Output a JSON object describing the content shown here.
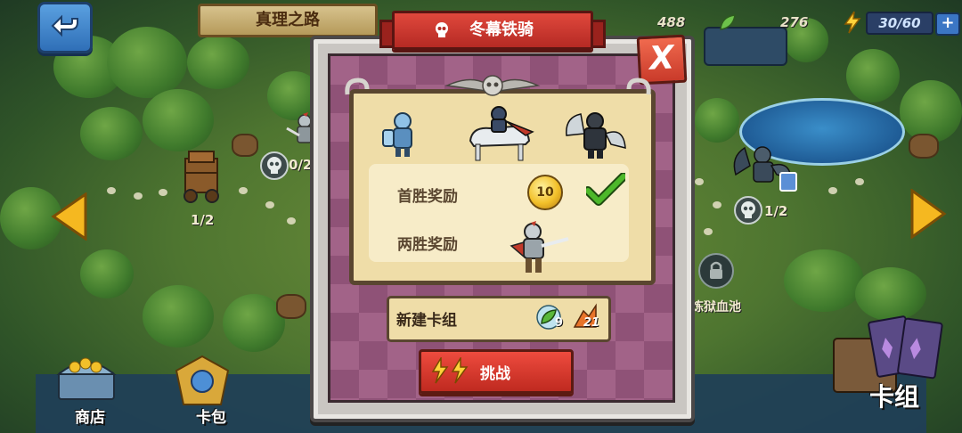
{
  "hud": {
    "map_title": "真理之路",
    "gems": "488",
    "leaves": "276",
    "energy": "30/60",
    "plus": "+"
  },
  "map_nodes": {
    "tower_progress": "1/2",
    "left_skull_progress": "0/2",
    "right_skull_progress": "1/2",
    "locked_location": "炼狱血池"
  },
  "bottom_nav": {
    "shop": "商店",
    "card_pack": "卡包",
    "deck": "卡组"
  },
  "modal": {
    "title": "冬幕铁骑",
    "close": "X",
    "first_win_label": "首胜奖励",
    "first_win_coin": "10",
    "two_win_label": "两胜奖励",
    "deck_label": "新建卡组",
    "leaf_cost": "9",
    "unit_count": "21",
    "challenge": "挑战"
  },
  "colors": {
    "accent_red": "#c93a2a",
    "parchment": "#efdda8",
    "board_purple": "#a26388",
    "check_green": "#4db82a"
  }
}
